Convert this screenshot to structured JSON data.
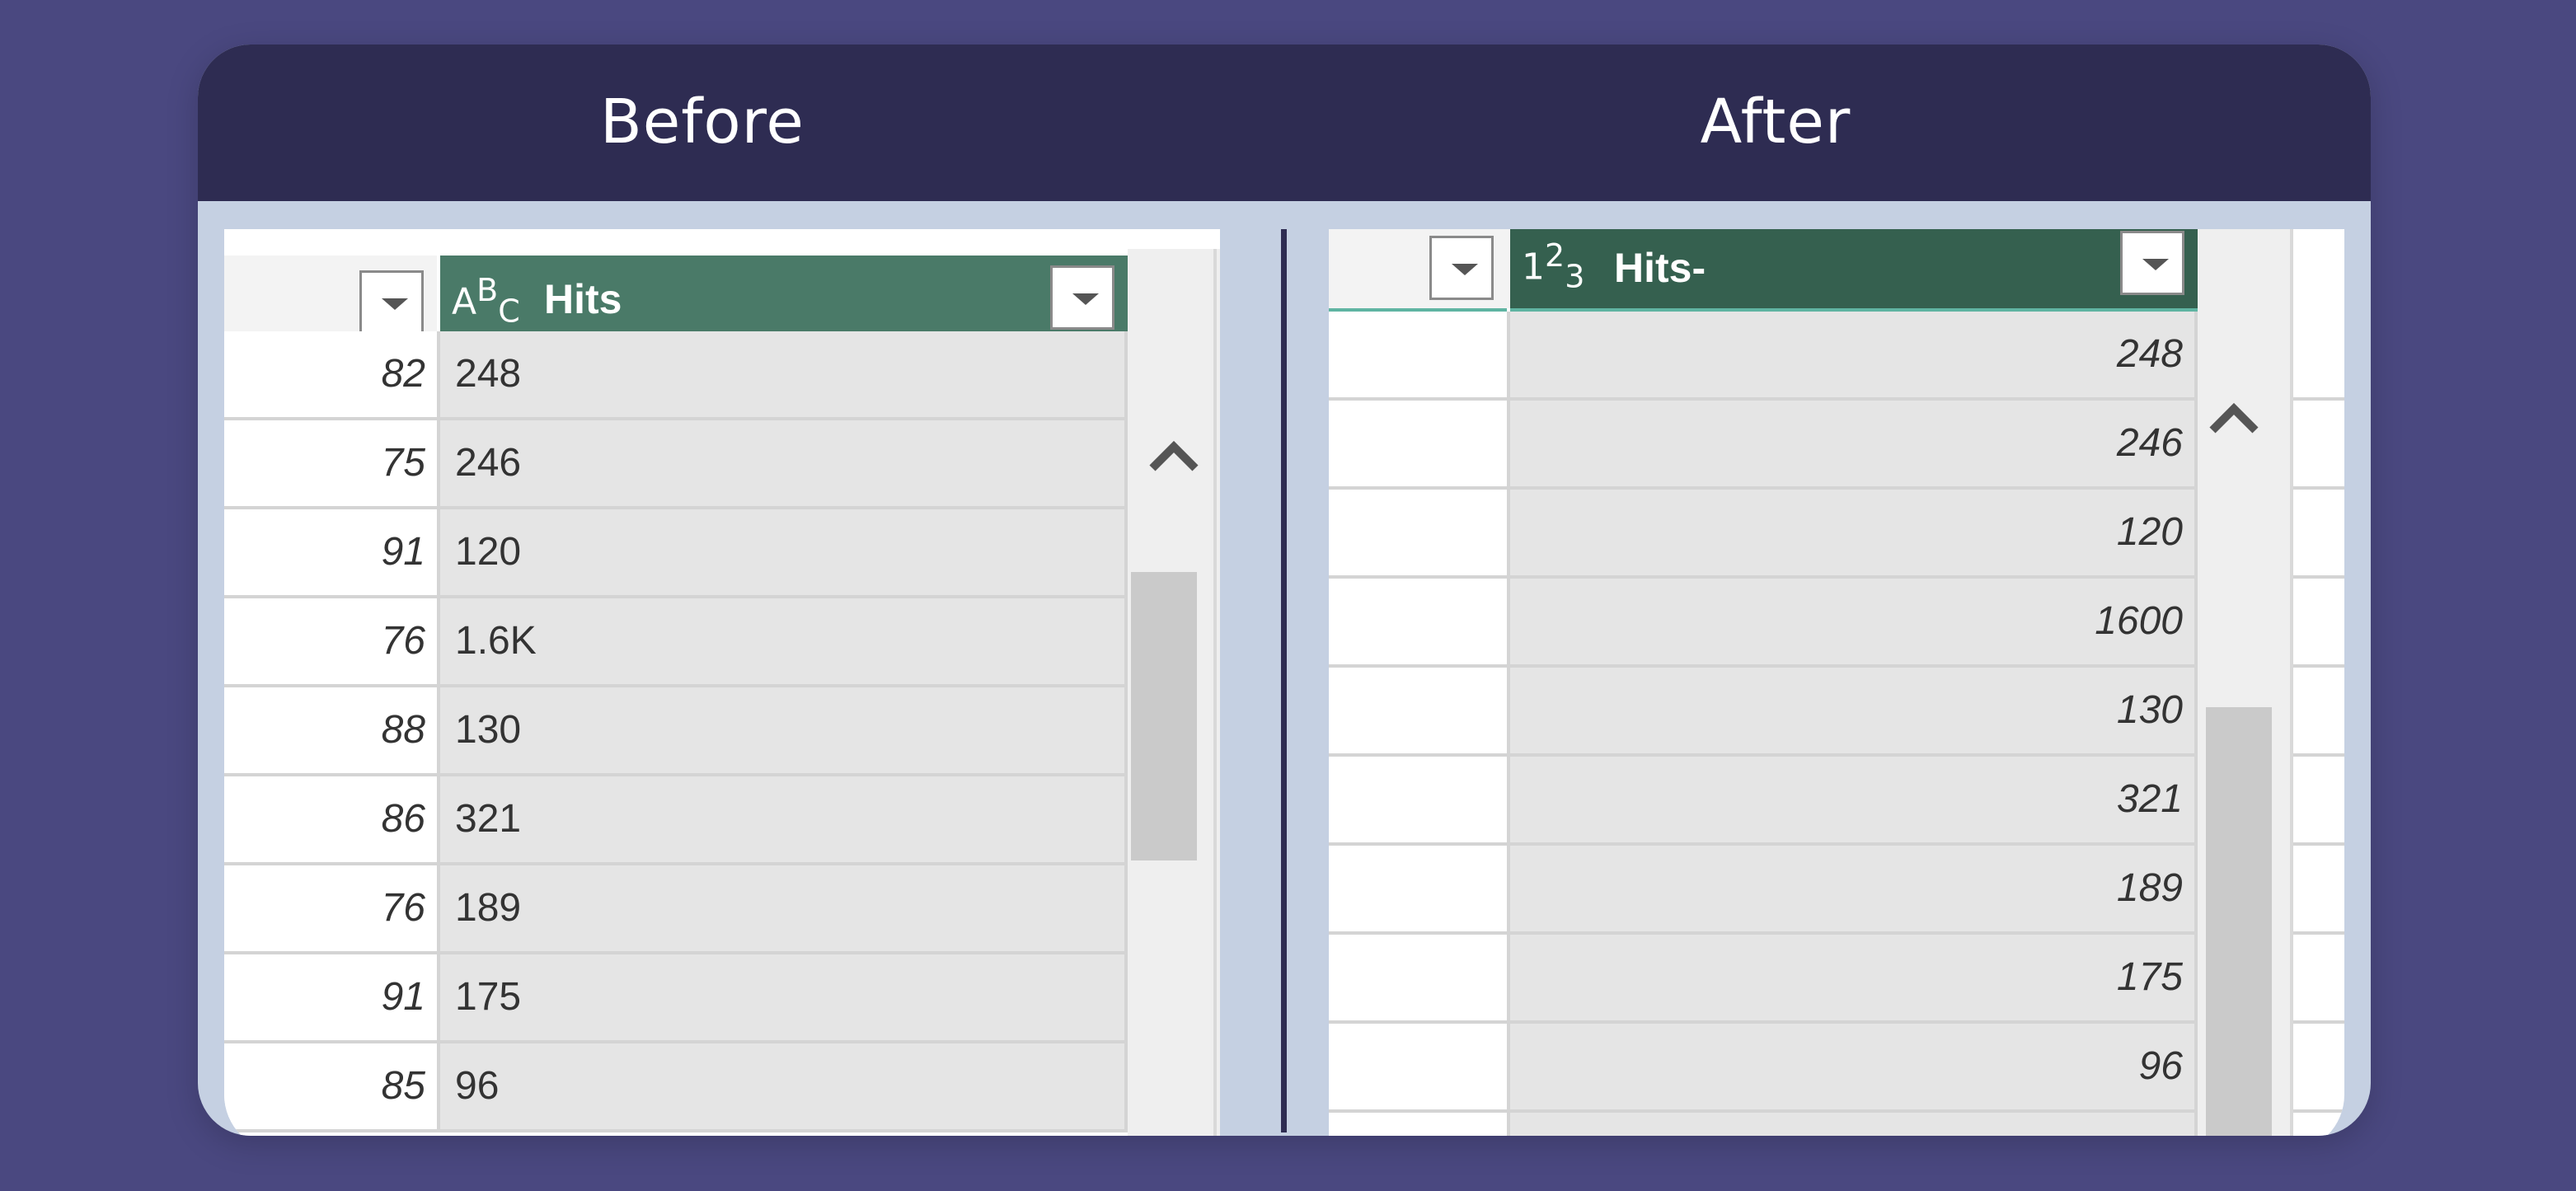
{
  "headers": {
    "before": "Before",
    "after": "After"
  },
  "before": {
    "column_type_icon": "text-type-icon",
    "column_type_glyph": {
      "a": "A",
      "b": "B",
      "c": "C"
    },
    "column_name": "Hits",
    "rows": [
      {
        "index": "82",
        "value": "248"
      },
      {
        "index": "75",
        "value": "246"
      },
      {
        "index": "91",
        "value": "120"
      },
      {
        "index": "76",
        "value": "1.6K"
      },
      {
        "index": "88",
        "value": "130"
      },
      {
        "index": "86",
        "value": "321"
      },
      {
        "index": "76",
        "value": "189"
      },
      {
        "index": "91",
        "value": "175"
      },
      {
        "index": "85",
        "value": "96"
      }
    ]
  },
  "after": {
    "column_type_icon": "whole-number-type-icon",
    "column_type_glyph": {
      "a": "1",
      "b": "2",
      "c": "3"
    },
    "column_name": "Hits-",
    "rows": [
      {
        "value": "248"
      },
      {
        "value": "246"
      },
      {
        "value": "120"
      },
      {
        "value": "1600"
      },
      {
        "value": "130"
      },
      {
        "value": "321"
      },
      {
        "value": "189"
      },
      {
        "value": "175"
      },
      {
        "value": "96"
      }
    ]
  },
  "colors": {
    "background": "#4a4880",
    "header_bar": "#2e2c52",
    "column_header_green": "#4a7a68",
    "column_header_dark_green": "#35604f",
    "column_accent_teal": "#5fb4a2",
    "cell_grey": "#e5e5e5"
  }
}
